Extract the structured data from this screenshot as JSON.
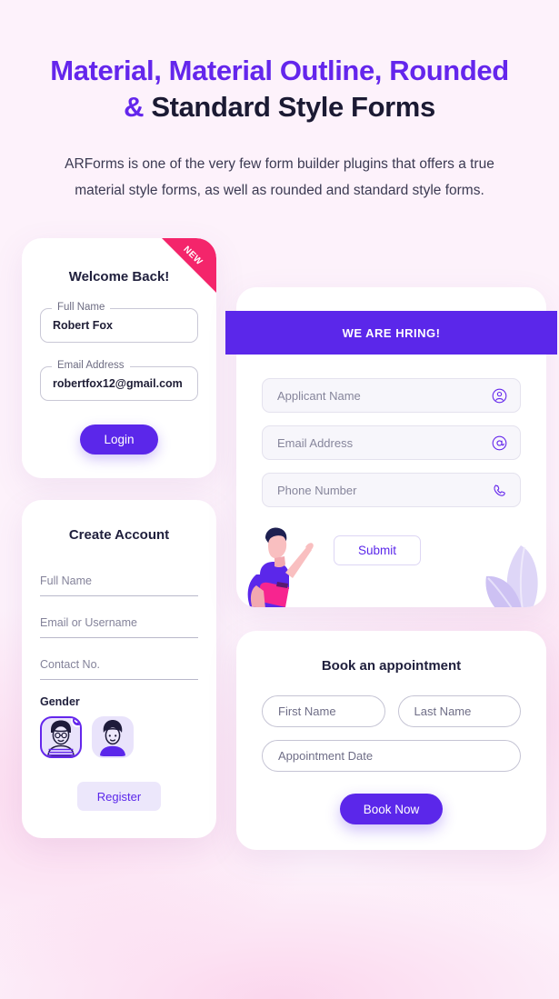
{
  "header": {
    "title_part1": "Material, Material Outline, Rounded &",
    "title_part2": " Standard Style Forms",
    "subtitle": "ARForms is one of the very few form builder plugins that offers a true material style forms, as well as rounded and standard style forms."
  },
  "login_card": {
    "ribbon": "NEW",
    "title": "Welcome Back!",
    "fields": [
      {
        "label": "Full Name",
        "value": "Robert Fox"
      },
      {
        "label": "Email Address",
        "value": "robertfox12@gmail.com"
      }
    ],
    "submit_label": "Login"
  },
  "register_card": {
    "title": "Create Account",
    "fields": [
      {
        "placeholder": "Full Name"
      },
      {
        "placeholder": "Email or Username"
      },
      {
        "placeholder": "Contact No."
      }
    ],
    "gender_label": "Gender",
    "genders": [
      {
        "name": "male",
        "selected": true
      },
      {
        "name": "female",
        "selected": false
      }
    ],
    "submit_label": "Register"
  },
  "hiring_card": {
    "banner_title": "WE ARE HRING!",
    "fields": [
      {
        "placeholder": "Applicant Name",
        "icon": "user-circle-icon"
      },
      {
        "placeholder": "Email Address",
        "icon": "at-circle-icon"
      },
      {
        "placeholder": "Phone Number",
        "icon": "phone-icon"
      }
    ],
    "submit_label": "Submit"
  },
  "appointment_card": {
    "title": "Book an appointment",
    "fields": [
      {
        "placeholder": "First Name"
      },
      {
        "placeholder": "Last Name"
      },
      {
        "placeholder": "Appointment Date"
      }
    ],
    "submit_label": "Book Now"
  },
  "colors": {
    "accent_purple": "#5b27ea",
    "title_purple": "#6426ec",
    "ribbon_pink": "#f4256b",
    "page_background": "#fdf2fb",
    "dark_text": "#1b1a33"
  }
}
